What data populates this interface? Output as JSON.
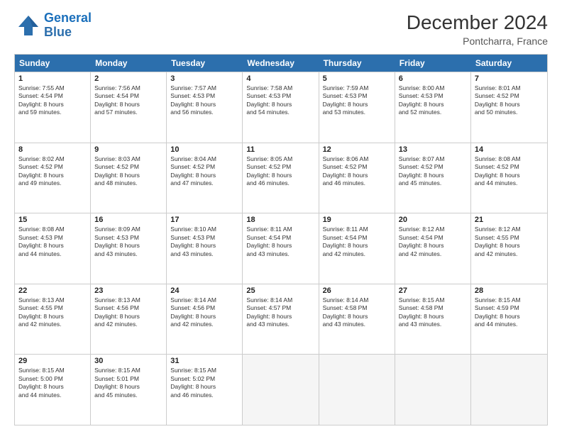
{
  "logo": {
    "line1": "General",
    "line2": "Blue"
  },
  "title": "December 2024",
  "location": "Pontcharra, France",
  "header_days": [
    "Sunday",
    "Monday",
    "Tuesday",
    "Wednesday",
    "Thursday",
    "Friday",
    "Saturday"
  ],
  "weeks": [
    [
      {
        "day": "1",
        "lines": [
          "Sunrise: 7:55 AM",
          "Sunset: 4:54 PM",
          "Daylight: 8 hours",
          "and 59 minutes."
        ]
      },
      {
        "day": "2",
        "lines": [
          "Sunrise: 7:56 AM",
          "Sunset: 4:54 PM",
          "Daylight: 8 hours",
          "and 57 minutes."
        ]
      },
      {
        "day": "3",
        "lines": [
          "Sunrise: 7:57 AM",
          "Sunset: 4:53 PM",
          "Daylight: 8 hours",
          "and 56 minutes."
        ]
      },
      {
        "day": "4",
        "lines": [
          "Sunrise: 7:58 AM",
          "Sunset: 4:53 PM",
          "Daylight: 8 hours",
          "and 54 minutes."
        ]
      },
      {
        "day": "5",
        "lines": [
          "Sunrise: 7:59 AM",
          "Sunset: 4:53 PM",
          "Daylight: 8 hours",
          "and 53 minutes."
        ]
      },
      {
        "day": "6",
        "lines": [
          "Sunrise: 8:00 AM",
          "Sunset: 4:53 PM",
          "Daylight: 8 hours",
          "and 52 minutes."
        ]
      },
      {
        "day": "7",
        "lines": [
          "Sunrise: 8:01 AM",
          "Sunset: 4:52 PM",
          "Daylight: 8 hours",
          "and 50 minutes."
        ]
      }
    ],
    [
      {
        "day": "8",
        "lines": [
          "Sunrise: 8:02 AM",
          "Sunset: 4:52 PM",
          "Daylight: 8 hours",
          "and 49 minutes."
        ]
      },
      {
        "day": "9",
        "lines": [
          "Sunrise: 8:03 AM",
          "Sunset: 4:52 PM",
          "Daylight: 8 hours",
          "and 48 minutes."
        ]
      },
      {
        "day": "10",
        "lines": [
          "Sunrise: 8:04 AM",
          "Sunset: 4:52 PM",
          "Daylight: 8 hours",
          "and 47 minutes."
        ]
      },
      {
        "day": "11",
        "lines": [
          "Sunrise: 8:05 AM",
          "Sunset: 4:52 PM",
          "Daylight: 8 hours",
          "and 46 minutes."
        ]
      },
      {
        "day": "12",
        "lines": [
          "Sunrise: 8:06 AM",
          "Sunset: 4:52 PM",
          "Daylight: 8 hours",
          "and 46 minutes."
        ]
      },
      {
        "day": "13",
        "lines": [
          "Sunrise: 8:07 AM",
          "Sunset: 4:52 PM",
          "Daylight: 8 hours",
          "and 45 minutes."
        ]
      },
      {
        "day": "14",
        "lines": [
          "Sunrise: 8:08 AM",
          "Sunset: 4:52 PM",
          "Daylight: 8 hours",
          "and 44 minutes."
        ]
      }
    ],
    [
      {
        "day": "15",
        "lines": [
          "Sunrise: 8:08 AM",
          "Sunset: 4:53 PM",
          "Daylight: 8 hours",
          "and 44 minutes."
        ]
      },
      {
        "day": "16",
        "lines": [
          "Sunrise: 8:09 AM",
          "Sunset: 4:53 PM",
          "Daylight: 8 hours",
          "and 43 minutes."
        ]
      },
      {
        "day": "17",
        "lines": [
          "Sunrise: 8:10 AM",
          "Sunset: 4:53 PM",
          "Daylight: 8 hours",
          "and 43 minutes."
        ]
      },
      {
        "day": "18",
        "lines": [
          "Sunrise: 8:11 AM",
          "Sunset: 4:54 PM",
          "Daylight: 8 hours",
          "and 43 minutes."
        ]
      },
      {
        "day": "19",
        "lines": [
          "Sunrise: 8:11 AM",
          "Sunset: 4:54 PM",
          "Daylight: 8 hours",
          "and 42 minutes."
        ]
      },
      {
        "day": "20",
        "lines": [
          "Sunrise: 8:12 AM",
          "Sunset: 4:54 PM",
          "Daylight: 8 hours",
          "and 42 minutes."
        ]
      },
      {
        "day": "21",
        "lines": [
          "Sunrise: 8:12 AM",
          "Sunset: 4:55 PM",
          "Daylight: 8 hours",
          "and 42 minutes."
        ]
      }
    ],
    [
      {
        "day": "22",
        "lines": [
          "Sunrise: 8:13 AM",
          "Sunset: 4:55 PM",
          "Daylight: 8 hours",
          "and 42 minutes."
        ]
      },
      {
        "day": "23",
        "lines": [
          "Sunrise: 8:13 AM",
          "Sunset: 4:56 PM",
          "Daylight: 8 hours",
          "and 42 minutes."
        ]
      },
      {
        "day": "24",
        "lines": [
          "Sunrise: 8:14 AM",
          "Sunset: 4:56 PM",
          "Daylight: 8 hours",
          "and 42 minutes."
        ]
      },
      {
        "day": "25",
        "lines": [
          "Sunrise: 8:14 AM",
          "Sunset: 4:57 PM",
          "Daylight: 8 hours",
          "and 43 minutes."
        ]
      },
      {
        "day": "26",
        "lines": [
          "Sunrise: 8:14 AM",
          "Sunset: 4:58 PM",
          "Daylight: 8 hours",
          "and 43 minutes."
        ]
      },
      {
        "day": "27",
        "lines": [
          "Sunrise: 8:15 AM",
          "Sunset: 4:58 PM",
          "Daylight: 8 hours",
          "and 43 minutes."
        ]
      },
      {
        "day": "28",
        "lines": [
          "Sunrise: 8:15 AM",
          "Sunset: 4:59 PM",
          "Daylight: 8 hours",
          "and 44 minutes."
        ]
      }
    ],
    [
      {
        "day": "29",
        "lines": [
          "Sunrise: 8:15 AM",
          "Sunset: 5:00 PM",
          "Daylight: 8 hours",
          "and 44 minutes."
        ]
      },
      {
        "day": "30",
        "lines": [
          "Sunrise: 8:15 AM",
          "Sunset: 5:01 PM",
          "Daylight: 8 hours",
          "and 45 minutes."
        ]
      },
      {
        "day": "31",
        "lines": [
          "Sunrise: 8:15 AM",
          "Sunset: 5:02 PM",
          "Daylight: 8 hours",
          "and 46 minutes."
        ]
      },
      {
        "day": "",
        "lines": []
      },
      {
        "day": "",
        "lines": []
      },
      {
        "day": "",
        "lines": []
      },
      {
        "day": "",
        "lines": []
      }
    ]
  ]
}
